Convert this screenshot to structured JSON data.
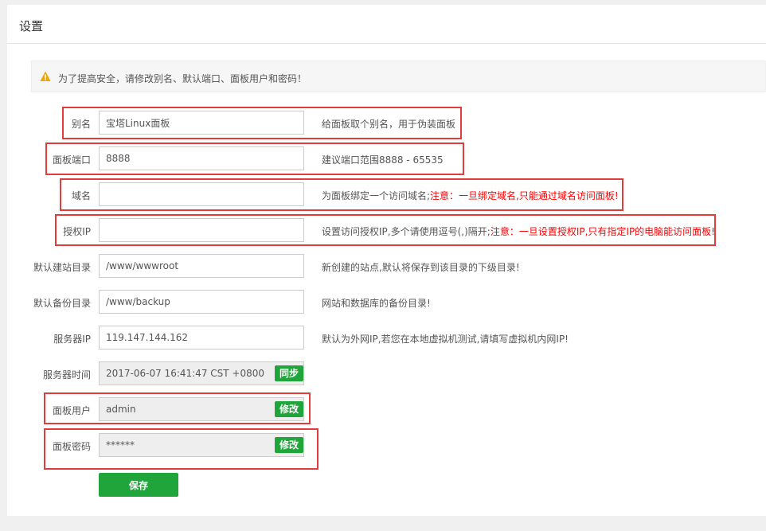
{
  "page": {
    "title": "设置"
  },
  "alert": {
    "text": "为了提高安全，请修改别名、默认端口、面板用户和密码！"
  },
  "form": {
    "alias": {
      "label": "别名",
      "value": "宝塔Linux面板",
      "hint": "给面板取个别名，用于伪装面板"
    },
    "port": {
      "label": "面板端口",
      "value": "8888",
      "hint": "建议端口范围8888 - 65535"
    },
    "domain": {
      "label": "域名",
      "value": "",
      "hint": "为面板绑定一个访问域名;",
      "warning": "注意：一旦绑定域名,只能通过域名访问面板!"
    },
    "auth_ip": {
      "label": "授权IP",
      "value": "",
      "hint": "设置访问授权IP,多个请使用逗号(,)隔开;",
      "warning": "注意：一旦设置授权IP,只有指定IP的电脑能访问面板!"
    },
    "site_dir": {
      "label": "默认建站目录",
      "value": "/www/wwwroot",
      "hint": "新创建的站点,默认将保存到该目录的下级目录!"
    },
    "backup_dir": {
      "label": "默认备份目录",
      "value": "/www/backup",
      "hint": "网站和数据库的备份目录!"
    },
    "server_ip": {
      "label": "服务器IP",
      "value": "119.147.144.162",
      "hint": "默认为外网IP,若您在本地虚拟机测试,请填写虚拟机内网IP!"
    },
    "server_time": {
      "label": "服务器时间",
      "value": "2017-06-07 16:41:47 CST +0800",
      "button": "同步"
    },
    "panel_user": {
      "label": "面板用户",
      "value": "admin",
      "button": "修改"
    },
    "panel_password": {
      "label": "面板密码",
      "value": "******",
      "button": "修改"
    },
    "save_label": "保存"
  },
  "colors": {
    "accent": "#20a53a",
    "highlight": "#e03c3c",
    "warning_text": "#ff0000",
    "alert_icon": "#f0a500"
  }
}
